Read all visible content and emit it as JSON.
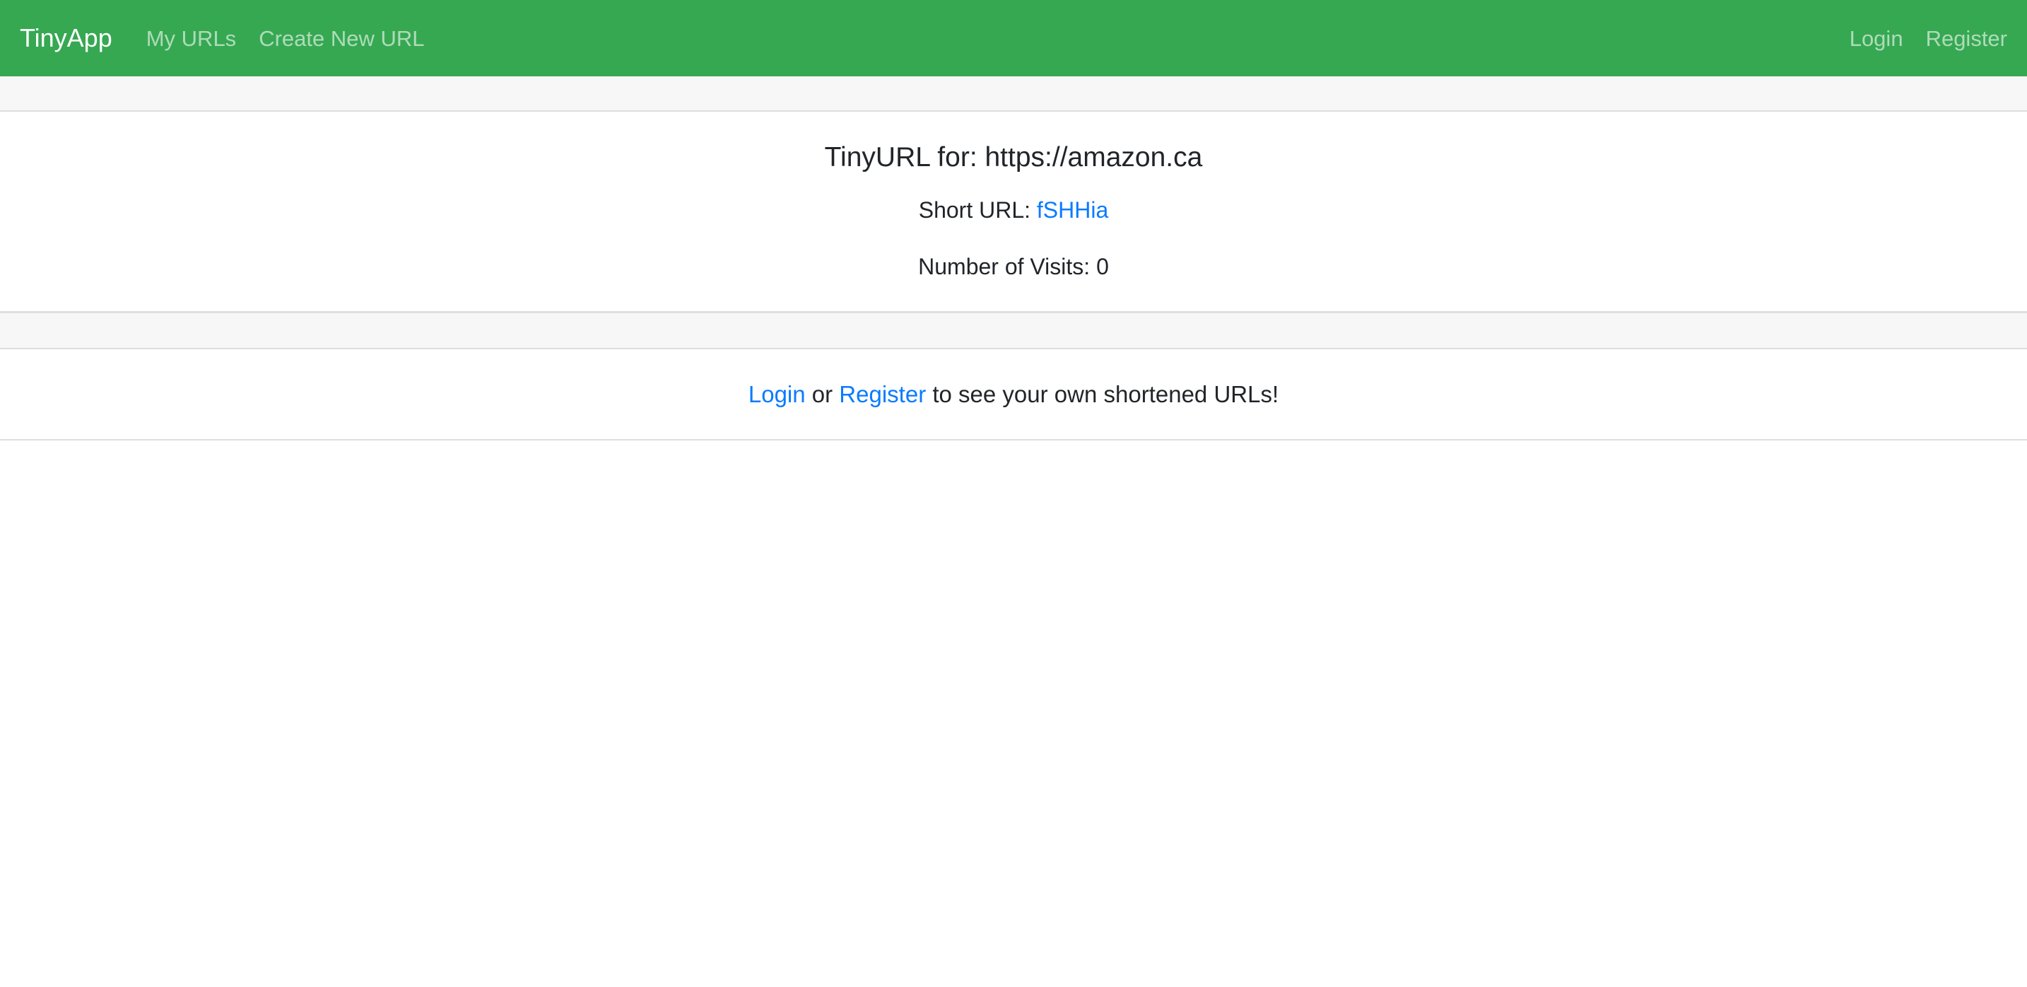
{
  "navbar": {
    "brand": "TinyApp",
    "left_links": [
      "My URLs",
      "Create New URL"
    ],
    "right_links": [
      "Login",
      "Register"
    ],
    "background_color": "#36a852"
  },
  "card": {
    "title": "TinyURL for: https://amazon.ca",
    "short_url_label": "Short URL:",
    "short_url_value": "fSHHia",
    "visits_label": "Number of Visits:",
    "visits_value": "0"
  },
  "prompt": {
    "login_link": "Login",
    "or_text": "or",
    "register_link": "Register",
    "suffix_text": "to see your own shortened URLs!",
    "link_color": "#0a7bff"
  }
}
